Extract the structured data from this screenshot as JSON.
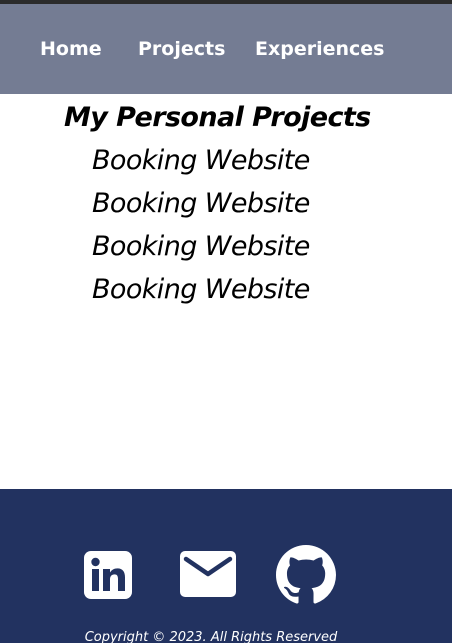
{
  "nav": {
    "home": "Home",
    "projects": "Projects",
    "experiences": "Experiences"
  },
  "main": {
    "title": "My Personal Projects",
    "projects": [
      "Booking Website",
      "Booking Website",
      "Booking Website",
      "Booking Website"
    ]
  },
  "footer": {
    "social_icons": [
      "linkedin-icon",
      "mail-icon",
      "github-icon"
    ],
    "copyright": "Copyright © 2023. All Rights Reserved"
  },
  "colors": {
    "nav_background": "#747c93",
    "footer_background": "#223260",
    "text_dark": "#000000",
    "text_light": "#ffffff"
  }
}
